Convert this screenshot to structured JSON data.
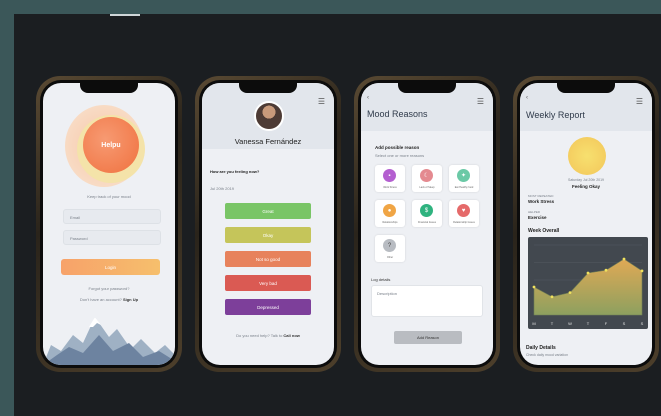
{
  "phone1": {
    "logo": "Helpu",
    "tagline": "Keep track of your mood",
    "email_placeholder": "Email",
    "password_placeholder": "Password",
    "login_label": "Login",
    "forgot_label": "Forgot your password?",
    "signup_prompt": "Don't have an account?",
    "signup_label": "Sign Up"
  },
  "phone2": {
    "name": "Vanessa Fernández",
    "question": "How are you feeling now?",
    "date": "Jul 20th 2019",
    "moods": [
      "Great",
      "Okay",
      "Not so good",
      "Very bad",
      "Depressed"
    ],
    "help_prompt": "Do you need help? Talk to",
    "help_link": "Call now"
  },
  "phone3": {
    "title": "Mood Reasons",
    "subtitle": "Add possible reason",
    "hint": "Select one or more reasons",
    "reasons": [
      "Work Stress",
      "Lack of Sleep",
      "Eat Healthy food",
      "Relationships",
      "Financial Issues",
      "Relationship Issues",
      "Other"
    ],
    "log_label": "Log details",
    "log_placeholder": "Description",
    "add_button": "Add Reason"
  },
  "phone4": {
    "title": "Weekly Report",
    "mood_date": "Saturday Jul 20th 2019",
    "mood_value": "Feeling Okay",
    "reason1_date": "MOST REPEATED",
    "reason1": "Work Stress",
    "reason2_date": "HELPED",
    "reason2": "Exercise",
    "overall_label": "Week Overall",
    "days": [
      "M",
      "T",
      "W",
      "T",
      "F",
      "S",
      "S"
    ],
    "daily_label": "Daily Details",
    "daily_sub": "Check daily mood variation"
  },
  "chart_data": {
    "type": "area",
    "categories": [
      "M",
      "T",
      "W",
      "T",
      "F",
      "S",
      "S"
    ],
    "values": [
      4,
      2.6,
      3.2,
      6,
      6.4,
      8,
      6.3
    ],
    "ylim": [
      0,
      10
    ],
    "grid": true,
    "colors": {
      "fill_top": "#e0a955",
      "fill_bottom": "#8da05f",
      "line": "#6e7d54",
      "point": "#f0e25e"
    }
  }
}
